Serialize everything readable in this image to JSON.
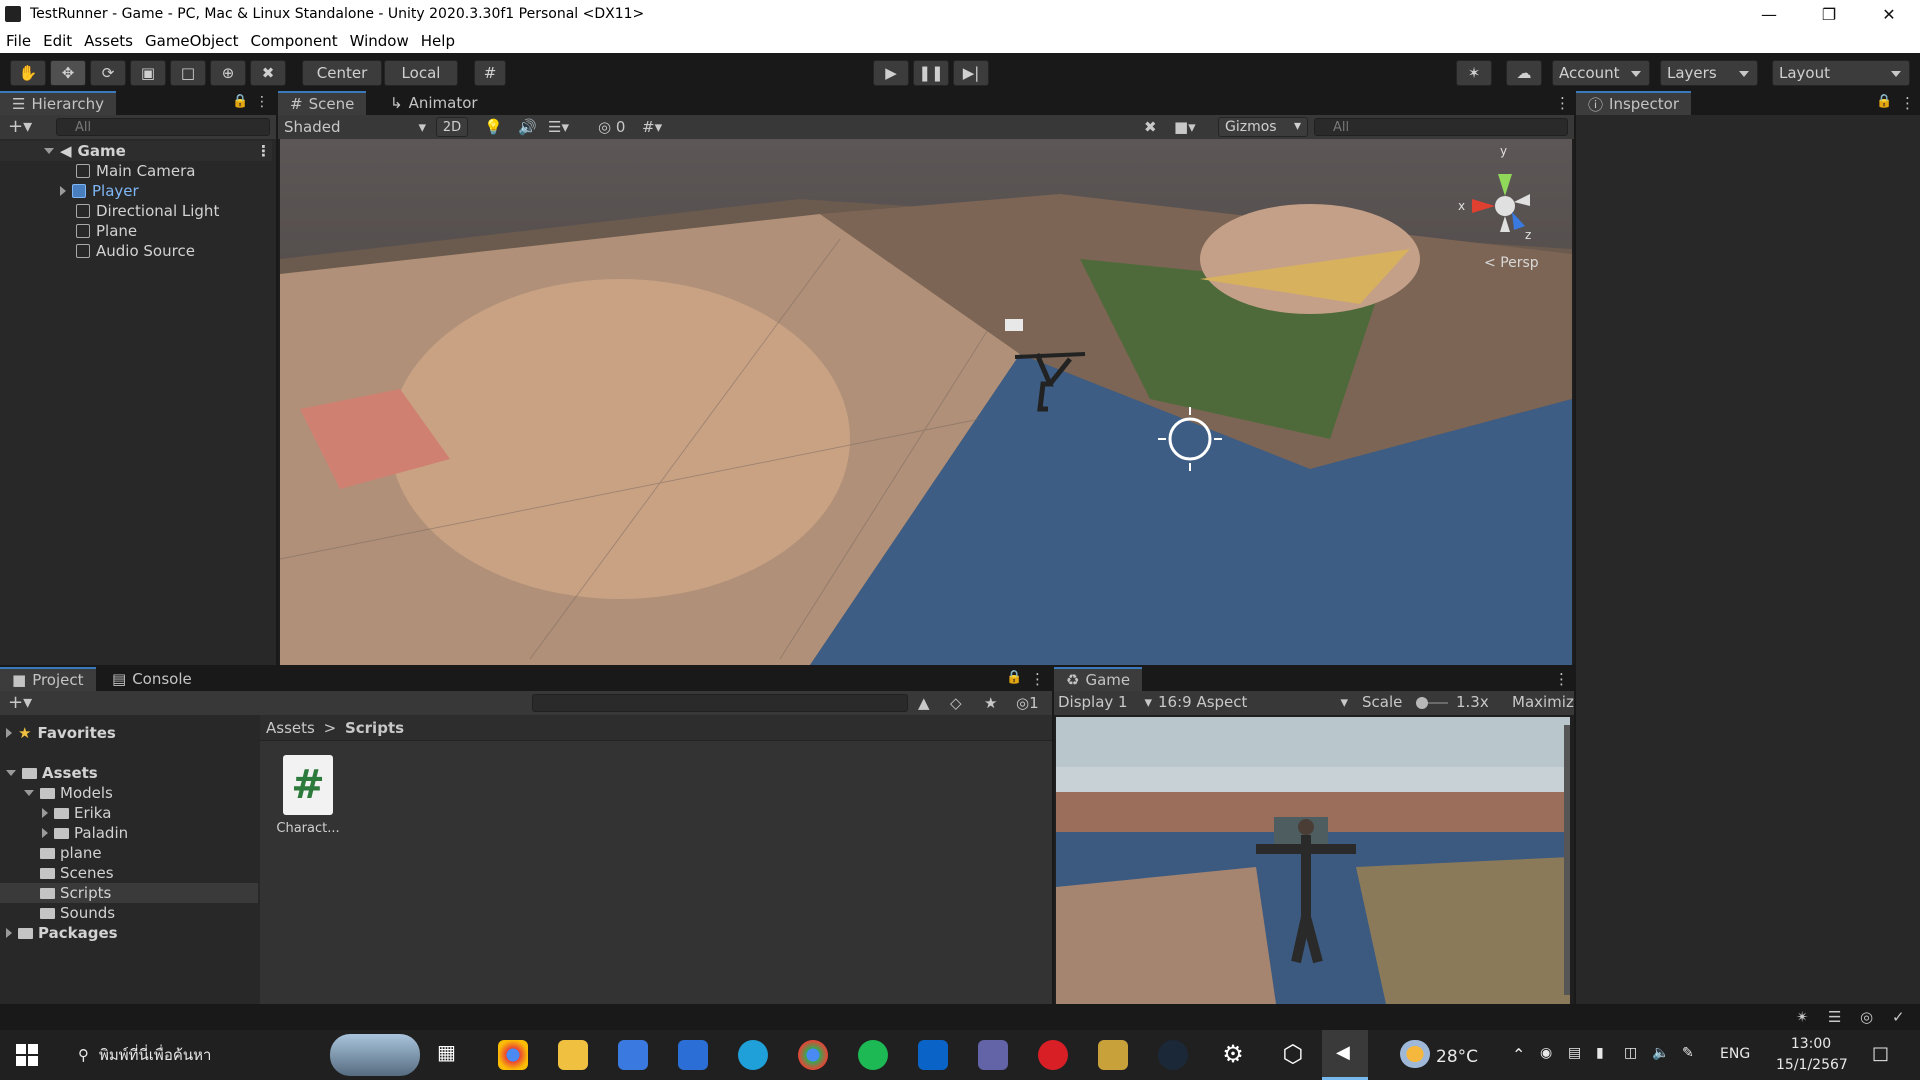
{
  "window": {
    "title": "TestRunner - Game - PC, Mac & Linux Standalone - Unity 2020.3.30f1 Personal <DX11>"
  },
  "menu": [
    "File",
    "Edit",
    "Assets",
    "GameObject",
    "Component",
    "Window",
    "Help"
  ],
  "toolbar": {
    "pivot": "Center",
    "space": "Local",
    "account": "Account",
    "layers": "Layers",
    "layout": "Layout"
  },
  "hierarchy": {
    "tab": "Hierarchy",
    "search": "All",
    "scene": "Game",
    "items": [
      "Main Camera",
      "Player",
      "Directional Light",
      "Plane",
      "Audio Source"
    ]
  },
  "scene_view": {
    "tabs": [
      "Scene",
      "Animator"
    ],
    "shading": "Shaded",
    "mode2d": "2D",
    "hidden_count": "0",
    "gizmos": "Gizmos",
    "search": "All",
    "projection": "Persp",
    "axes": {
      "x": "x",
      "y": "y",
      "z": "z"
    }
  },
  "inspector": {
    "tab": "Inspector"
  },
  "project": {
    "tabs": [
      "Project",
      "Console"
    ],
    "breadcrumb": [
      "Assets",
      "Scripts"
    ],
    "hidden_count": "1",
    "favorites": "Favorites",
    "assets": "Assets",
    "tree": [
      "Models",
      "Erika",
      "Paladin",
      "plane",
      "Scenes",
      "Scripts",
      "Sounds"
    ],
    "packages": "Packages",
    "file": "Charact..."
  },
  "game_view": {
    "tab": "Game",
    "display": "Display 1",
    "aspect": "16:9 Aspect",
    "scale_label": "Scale",
    "scale_value": "1.3x",
    "maximize": "Maximiz"
  },
  "taskbar": {
    "search": "พิมพ์ที่นี่เพื่อค้นหา",
    "weather": "28°C",
    "lang": "ENG",
    "time": "13:00",
    "date": "15/1/2567"
  },
  "colors": {
    "accent": "#3a79bb",
    "player": "#7fb6f5",
    "panel": "#282828"
  }
}
